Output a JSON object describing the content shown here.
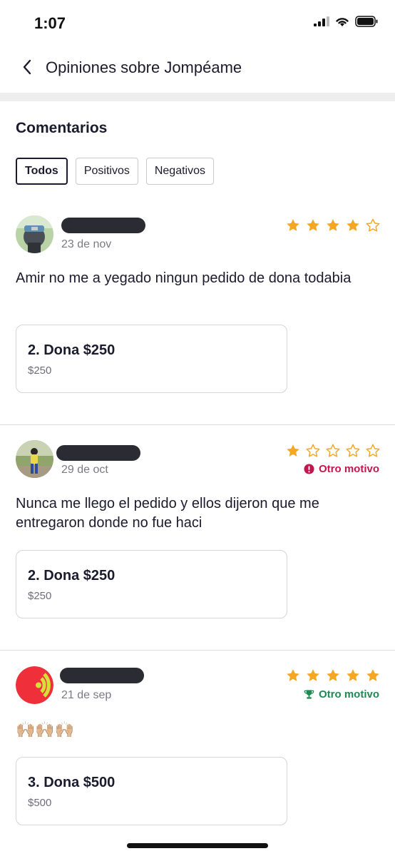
{
  "status": {
    "time": "1:07"
  },
  "nav": {
    "title": "Opiniones sobre Jompéame",
    "back_icon": "chevron-left-icon"
  },
  "section": {
    "title": "Comentarios"
  },
  "filters": [
    {
      "label": "Todos",
      "active": true
    },
    {
      "label": "Positivos",
      "active": false
    },
    {
      "label": "Negativos",
      "active": false
    }
  ],
  "reviews": [
    {
      "date": "23 de nov",
      "rating": 4,
      "comment": "Amir no me a yegado ningun pedido de dona todabia",
      "product": {
        "name": "2. Dona $250",
        "price": "$250"
      }
    },
    {
      "date": "29 de oct",
      "rating": 1,
      "tag": "Otro motivo",
      "comment": "Nunca me llego el pedido y ellos dijeron que me entregaron donde no fue haci",
      "product": {
        "name": "2. Dona $250",
        "price": "$250"
      }
    },
    {
      "date": "21 de sep",
      "rating": 5,
      "tag": "Otro motivo",
      "comment": "🙌🏼🙌🏼🙌🏼",
      "product": {
        "name": "3. Dona $500",
        "price": "$500"
      }
    }
  ],
  "colors": {
    "star": "#f5a623",
    "negative": "#c4154d",
    "positive": "#1d8a53",
    "text": "#1c1b2e"
  }
}
